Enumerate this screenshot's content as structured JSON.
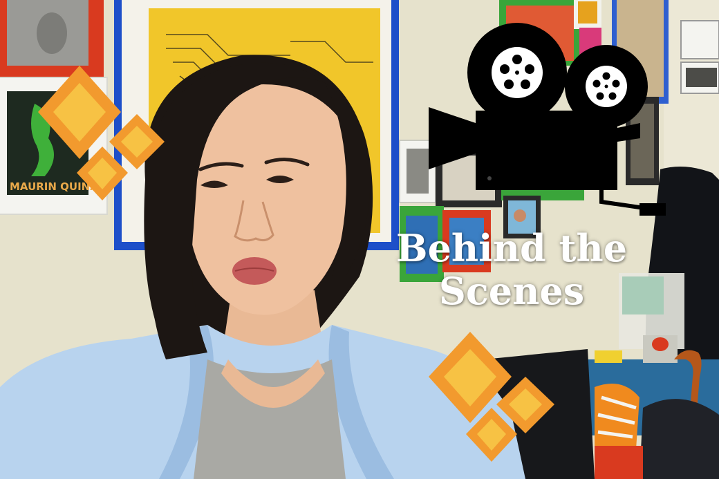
{
  "overlay_text": {
    "line1": "Behind the",
    "line2": "Scenes"
  },
  "poster_text": "MAURIN QUINA",
  "icons": {
    "camera": "movie-camera-icon",
    "sparkle": "sparkle-icon"
  },
  "colors": {
    "wall": "#e8e4cf",
    "sparkle_outer": "#f29a2e",
    "sparkle_inner": "#f7c244",
    "camera": "#000000",
    "title_text": "#ffffff",
    "shirt": "#b8d3ee",
    "frame_blue": "#1d4fc9",
    "frame_red": "#d93a1f",
    "frame_green": "#3aa53a",
    "poster_yellow": "#f1c62a"
  }
}
